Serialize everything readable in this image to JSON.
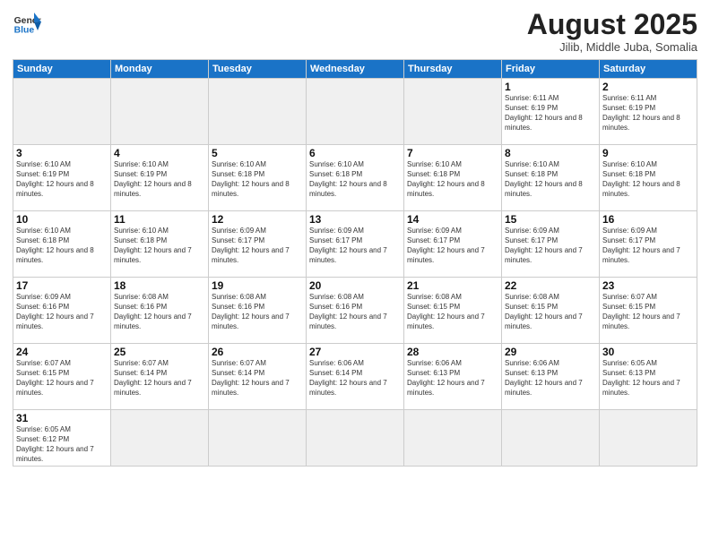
{
  "logo": {
    "general": "General",
    "blue": "Blue"
  },
  "title": "August 2025",
  "subtitle": "Jilib, Middle Juba, Somalia",
  "weekdays": [
    "Sunday",
    "Monday",
    "Tuesday",
    "Wednesday",
    "Thursday",
    "Friday",
    "Saturday"
  ],
  "weeks": [
    [
      {
        "day": "",
        "info": "",
        "empty": true
      },
      {
        "day": "",
        "info": "",
        "empty": true
      },
      {
        "day": "",
        "info": "",
        "empty": true
      },
      {
        "day": "",
        "info": "",
        "empty": true
      },
      {
        "day": "",
        "info": "",
        "empty": true
      },
      {
        "day": "1",
        "info": "Sunrise: 6:11 AM\nSunset: 6:19 PM\nDaylight: 12 hours and 8 minutes."
      },
      {
        "day": "2",
        "info": "Sunrise: 6:11 AM\nSunset: 6:19 PM\nDaylight: 12 hours and 8 minutes."
      }
    ],
    [
      {
        "day": "3",
        "info": "Sunrise: 6:10 AM\nSunset: 6:19 PM\nDaylight: 12 hours and 8 minutes."
      },
      {
        "day": "4",
        "info": "Sunrise: 6:10 AM\nSunset: 6:19 PM\nDaylight: 12 hours and 8 minutes."
      },
      {
        "day": "5",
        "info": "Sunrise: 6:10 AM\nSunset: 6:18 PM\nDaylight: 12 hours and 8 minutes."
      },
      {
        "day": "6",
        "info": "Sunrise: 6:10 AM\nSunset: 6:18 PM\nDaylight: 12 hours and 8 minutes."
      },
      {
        "day": "7",
        "info": "Sunrise: 6:10 AM\nSunset: 6:18 PM\nDaylight: 12 hours and 8 minutes."
      },
      {
        "day": "8",
        "info": "Sunrise: 6:10 AM\nSunset: 6:18 PM\nDaylight: 12 hours and 8 minutes."
      },
      {
        "day": "9",
        "info": "Sunrise: 6:10 AM\nSunset: 6:18 PM\nDaylight: 12 hours and 8 minutes."
      }
    ],
    [
      {
        "day": "10",
        "info": "Sunrise: 6:10 AM\nSunset: 6:18 PM\nDaylight: 12 hours and 8 minutes."
      },
      {
        "day": "11",
        "info": "Sunrise: 6:10 AM\nSunset: 6:18 PM\nDaylight: 12 hours and 7 minutes."
      },
      {
        "day": "12",
        "info": "Sunrise: 6:09 AM\nSunset: 6:17 PM\nDaylight: 12 hours and 7 minutes."
      },
      {
        "day": "13",
        "info": "Sunrise: 6:09 AM\nSunset: 6:17 PM\nDaylight: 12 hours and 7 minutes."
      },
      {
        "day": "14",
        "info": "Sunrise: 6:09 AM\nSunset: 6:17 PM\nDaylight: 12 hours and 7 minutes."
      },
      {
        "day": "15",
        "info": "Sunrise: 6:09 AM\nSunset: 6:17 PM\nDaylight: 12 hours and 7 minutes."
      },
      {
        "day": "16",
        "info": "Sunrise: 6:09 AM\nSunset: 6:17 PM\nDaylight: 12 hours and 7 minutes."
      }
    ],
    [
      {
        "day": "17",
        "info": "Sunrise: 6:09 AM\nSunset: 6:16 PM\nDaylight: 12 hours and 7 minutes."
      },
      {
        "day": "18",
        "info": "Sunrise: 6:08 AM\nSunset: 6:16 PM\nDaylight: 12 hours and 7 minutes."
      },
      {
        "day": "19",
        "info": "Sunrise: 6:08 AM\nSunset: 6:16 PM\nDaylight: 12 hours and 7 minutes."
      },
      {
        "day": "20",
        "info": "Sunrise: 6:08 AM\nSunset: 6:16 PM\nDaylight: 12 hours and 7 minutes."
      },
      {
        "day": "21",
        "info": "Sunrise: 6:08 AM\nSunset: 6:15 PM\nDaylight: 12 hours and 7 minutes."
      },
      {
        "day": "22",
        "info": "Sunrise: 6:08 AM\nSunset: 6:15 PM\nDaylight: 12 hours and 7 minutes."
      },
      {
        "day": "23",
        "info": "Sunrise: 6:07 AM\nSunset: 6:15 PM\nDaylight: 12 hours and 7 minutes."
      }
    ],
    [
      {
        "day": "24",
        "info": "Sunrise: 6:07 AM\nSunset: 6:15 PM\nDaylight: 12 hours and 7 minutes."
      },
      {
        "day": "25",
        "info": "Sunrise: 6:07 AM\nSunset: 6:14 PM\nDaylight: 12 hours and 7 minutes."
      },
      {
        "day": "26",
        "info": "Sunrise: 6:07 AM\nSunset: 6:14 PM\nDaylight: 12 hours and 7 minutes."
      },
      {
        "day": "27",
        "info": "Sunrise: 6:06 AM\nSunset: 6:14 PM\nDaylight: 12 hours and 7 minutes."
      },
      {
        "day": "28",
        "info": "Sunrise: 6:06 AM\nSunset: 6:13 PM\nDaylight: 12 hours and 7 minutes."
      },
      {
        "day": "29",
        "info": "Sunrise: 6:06 AM\nSunset: 6:13 PM\nDaylight: 12 hours and 7 minutes."
      },
      {
        "day": "30",
        "info": "Sunrise: 6:05 AM\nSunset: 6:13 PM\nDaylight: 12 hours and 7 minutes."
      }
    ],
    [
      {
        "day": "31",
        "info": "Sunrise: 6:05 AM\nSunset: 6:12 PM\nDaylight: 12 hours and 7 minutes."
      },
      {
        "day": "",
        "info": "",
        "empty": true
      },
      {
        "day": "",
        "info": "",
        "empty": true
      },
      {
        "day": "",
        "info": "",
        "empty": true
      },
      {
        "day": "",
        "info": "",
        "empty": true
      },
      {
        "day": "",
        "info": "",
        "empty": true
      },
      {
        "day": "",
        "info": "",
        "empty": true
      }
    ]
  ]
}
